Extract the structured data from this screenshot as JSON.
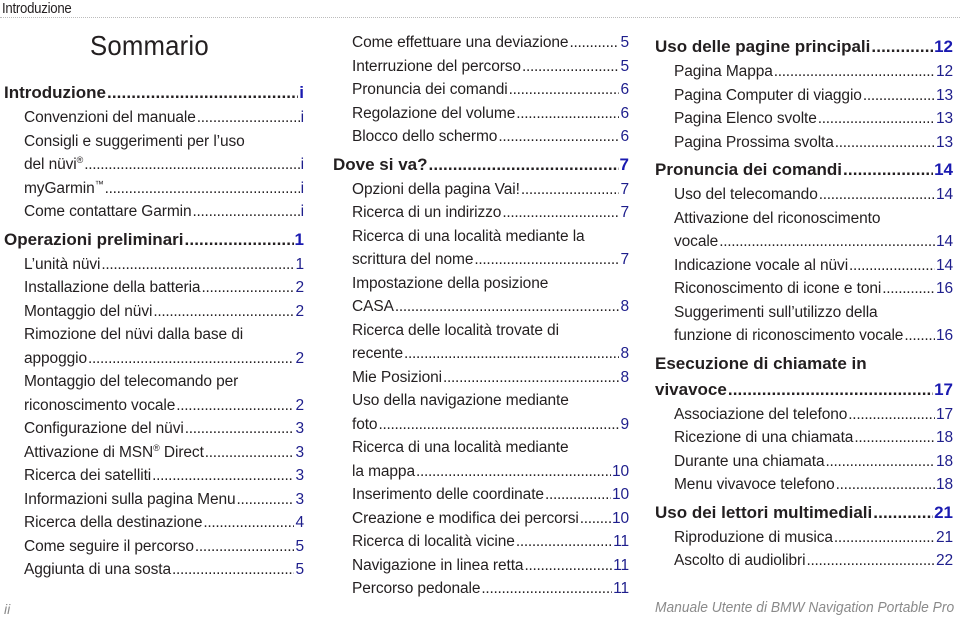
{
  "header": {
    "section_label": "Introduzione"
  },
  "title": "Sommario",
  "columns": [
    {
      "entries": [
        {
          "type": "section",
          "text": "Introduzione",
          "page": "i"
        },
        {
          "type": "sub",
          "text": "Convenzioni del manuale",
          "page": "i"
        },
        {
          "type": "sub",
          "first_line": "Consigli e suggerimenti per l’uso",
          "text": "del nüvi",
          "sup": "®",
          "page": "i"
        },
        {
          "type": "sub",
          "text": "myGarmin",
          "sup": "™",
          "page": "i"
        },
        {
          "type": "sub",
          "text": "Come contattare Garmin",
          "page": "i"
        },
        {
          "type": "section",
          "text": "Operazioni preliminari",
          "page": "1"
        },
        {
          "type": "sub",
          "text": "L’unità nüvi",
          "page": "1"
        },
        {
          "type": "sub",
          "text": "Installazione della batteria",
          "page": "2"
        },
        {
          "type": "sub",
          "text": "Montaggio del nüvi",
          "page": "2"
        },
        {
          "type": "sub",
          "first_line": "Rimozione del nüvi dalla base di",
          "text": "appoggio",
          "page": "2"
        },
        {
          "type": "sub",
          "first_line": "Montaggio del telecomando per",
          "text": "riconoscimento vocale",
          "page": "2"
        },
        {
          "type": "sub",
          "text": "Configurazione del nüvi",
          "page": "3"
        },
        {
          "type": "sub",
          "text": "Attivazione di MSN",
          "sup": "®",
          "text_after": " Direct",
          "page": "3"
        },
        {
          "type": "sub",
          "text": "Ricerca dei satelliti",
          "page": "3"
        },
        {
          "type": "sub",
          "text": "Informazioni sulla pagina Menu",
          "page": "3"
        },
        {
          "type": "sub",
          "text": "Ricerca della destinazione",
          "page": "4"
        },
        {
          "type": "sub",
          "text": "Come seguire il percorso",
          "page": "5"
        },
        {
          "type": "sub",
          "text": "Aggiunta di una sosta",
          "page": "5"
        }
      ]
    },
    {
      "entries": [
        {
          "type": "sub",
          "text": "Come effettuare una deviazione",
          "page": "5"
        },
        {
          "type": "sub",
          "text": "Interruzione del percorso",
          "page": "5"
        },
        {
          "type": "sub",
          "text": "Pronuncia dei comandi",
          "page": "6"
        },
        {
          "type": "sub",
          "text": "Regolazione del volume",
          "page": "6"
        },
        {
          "type": "sub",
          "text": "Blocco dello schermo",
          "page": "6"
        },
        {
          "type": "section",
          "text": "Dove si va?",
          "page": "7"
        },
        {
          "type": "sub",
          "text": "Opzioni della pagina Vai!",
          "page": "7"
        },
        {
          "type": "sub",
          "text": "Ricerca di un indirizzo",
          "page": "7"
        },
        {
          "type": "sub",
          "first_line": "Ricerca di una località mediante la",
          "text": "scrittura del nome",
          "page": "7"
        },
        {
          "type": "sub",
          "first_line": "Impostazione della posizione",
          "text": "CASA",
          "page": "8"
        },
        {
          "type": "sub",
          "first_line": "Ricerca delle località trovate di",
          "text": "recente",
          "page": "8"
        },
        {
          "type": "sub",
          "text": "Mie Posizioni",
          "page": "8"
        },
        {
          "type": "sub",
          "first_line": "Uso della navigazione mediante",
          "text": "foto",
          "page": "9"
        },
        {
          "type": "sub",
          "first_line": "Ricerca di una località mediante",
          "text": "la mappa",
          "page": "10"
        },
        {
          "type": "sub",
          "text": "Inserimento delle coordinate",
          "page": "10"
        },
        {
          "type": "sub",
          "text": "Creazione e modifica dei percorsi",
          "page": "10"
        },
        {
          "type": "sub",
          "text": "Ricerca di località vicine",
          "page": "11"
        },
        {
          "type": "sub",
          "text": "Navigazione in linea retta",
          "page": "11"
        },
        {
          "type": "sub",
          "text": "Percorso pedonale",
          "page": "11"
        }
      ]
    },
    {
      "entries": [
        {
          "type": "section",
          "text": "Uso delle pagine principali",
          "page": "12"
        },
        {
          "type": "sub",
          "text": "Pagina Mappa",
          "page": "12"
        },
        {
          "type": "sub",
          "text": "Pagina Computer di viaggio",
          "page": "13"
        },
        {
          "type": "sub",
          "text": "Pagina Elenco svolte",
          "page": "13"
        },
        {
          "type": "sub",
          "text": "Pagina Prossima svolta",
          "page": "13"
        },
        {
          "type": "section",
          "text": "Pronuncia dei comandi",
          "page": "14"
        },
        {
          "type": "sub",
          "text": "Uso del telecomando",
          "page": "14"
        },
        {
          "type": "sub",
          "first_line": "Attivazione del riconoscimento",
          "text": "vocale",
          "page": "14"
        },
        {
          "type": "sub",
          "text": "Indicazione vocale al nüvi",
          "page": "14"
        },
        {
          "type": "sub",
          "text": "Riconoscimento di icone e toni",
          "page": "16"
        },
        {
          "type": "sub",
          "first_line": "Suggerimenti sull’utilizzo della",
          "text": "funzione di riconoscimento vocale",
          "page": "16"
        },
        {
          "type": "section",
          "first_line": "Esecuzione di chiamate in",
          "text": "vivavoce",
          "page": "17"
        },
        {
          "type": "sub",
          "text": "Associazione del telefono",
          "page": "17"
        },
        {
          "type": "sub",
          "text": "Ricezione di una chiamata",
          "page": "18"
        },
        {
          "type": "sub",
          "text": "Durante una chiamata",
          "page": "18"
        },
        {
          "type": "sub",
          "text": "Menu vivavoce telefono",
          "page": "18"
        },
        {
          "type": "section",
          "text": "Uso dei lettori multimediali",
          "page": "21"
        },
        {
          "type": "sub",
          "text": "Riproduzione di musica",
          "page": "21"
        },
        {
          "type": "sub",
          "text": "Ascolto di audiolibri",
          "page": "22"
        }
      ]
    }
  ],
  "footer": {
    "page_number": "ii",
    "manual_title": "Manuale Utente di BMW Navigation Portable Pro"
  }
}
